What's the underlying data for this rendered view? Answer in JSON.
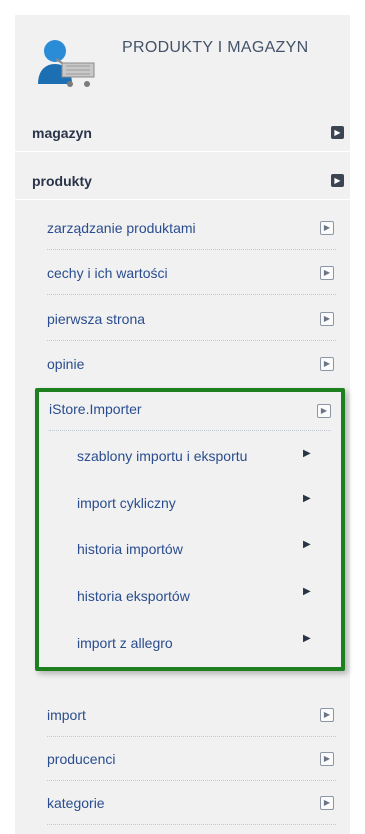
{
  "header": {
    "title": "PRODUKTY I MAGAZYN"
  },
  "main_items": [
    {
      "label": "magazyn"
    },
    {
      "label": "produkty"
    }
  ],
  "sub_items_top": [
    {
      "label": "zarządzanie produktami"
    },
    {
      "label": "cechy i ich wartości"
    },
    {
      "label": "pierwsza strona"
    },
    {
      "label": "opinie"
    }
  ],
  "importer": {
    "label": "iStore.Importer",
    "items": [
      {
        "label": "szablony importu i eksportu"
      },
      {
        "label": "import cykliczny"
      },
      {
        "label": "historia importów"
      },
      {
        "label": "historia eksportów"
      },
      {
        "label": "import z allegro"
      }
    ]
  },
  "sub_items_bottom": [
    {
      "label": "import"
    },
    {
      "label": "producenci"
    },
    {
      "label": "kategorie"
    }
  ],
  "icons": {
    "header": "user-cart-icon",
    "main_arrow": "arrow-right-dark-icon",
    "sub_arrow": "arrow-right-light-icon",
    "nested_arrow": "triangle-right-icon"
  },
  "colors": {
    "highlight_border": "#1e7f1e",
    "link": "#2a4d8f",
    "panel_bg": "#f1f1f1"
  }
}
